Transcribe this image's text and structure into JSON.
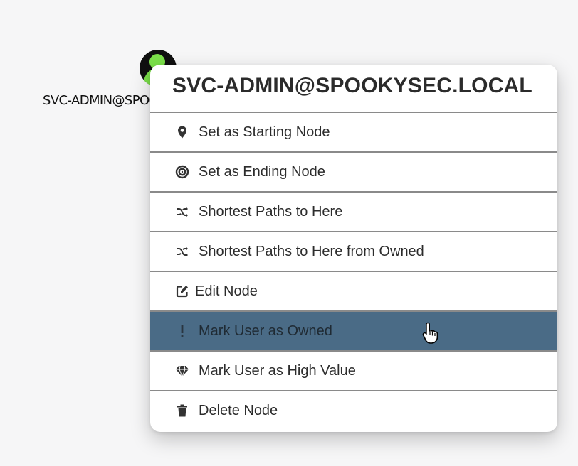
{
  "graph": {
    "node_label": "SVC-ADMIN@SPOOKYSEC.LOCAL"
  },
  "menu": {
    "title": "SVC-ADMIN@SPOOKYSEC.LOCAL",
    "items": [
      {
        "label": "Set as Starting Node",
        "icon": "map-marker-icon"
      },
      {
        "label": "Set as Ending Node",
        "icon": "target-icon"
      },
      {
        "label": "Shortest Paths to Here",
        "icon": "shuffle-icon"
      },
      {
        "label": "Shortest Paths to Here from Owned",
        "icon": "shuffle-icon"
      },
      {
        "label": "Edit Node",
        "icon": "edit-icon"
      },
      {
        "label": "Mark User as Owned",
        "icon": "exclamation-icon",
        "highlighted": true
      },
      {
        "label": "Mark User as High Value",
        "icon": "gem-icon"
      },
      {
        "label": "Delete Node",
        "icon": "trash-icon"
      }
    ]
  },
  "colors": {
    "highlight": "#4a6b86",
    "node_green": "#7be04a"
  }
}
